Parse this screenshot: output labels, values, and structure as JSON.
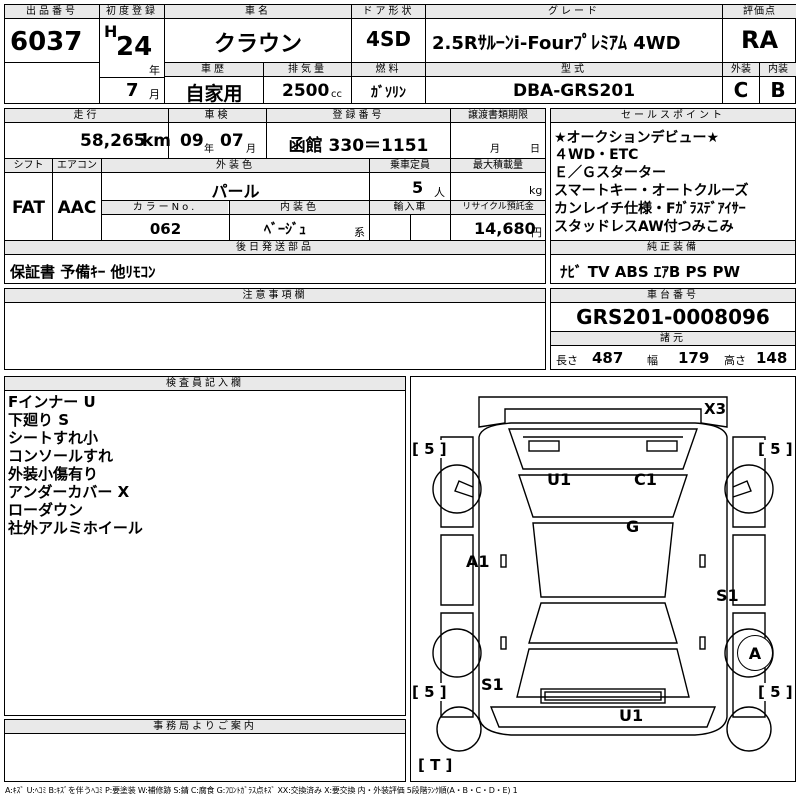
{
  "row1": {
    "lot_number_label": "出品番号",
    "lot_number": "6037",
    "first_reg_label": "初度登録",
    "era": "H",
    "year": "24",
    "year_unit": "年",
    "month": "7",
    "month_unit": "月",
    "car_name_label": "車名",
    "car_name": "クラウン",
    "door_label": "ドア形状",
    "door": "4SD",
    "grade_label": "グレード",
    "grade": "2.5Rｻﾙｰﾝi-Fourﾌﾟﾚﾐｱﾑ 4WD",
    "score_label": "評価点",
    "score": "RA",
    "history_label": "車歴",
    "history": "自家用",
    "displacement_label": "排気量",
    "displacement": "2500",
    "displacement_unit": "cc",
    "fuel_label": "燃料",
    "fuel": "ｶﾞｿﾘﾝ",
    "model_label": "型式",
    "model": "DBA-GRS201",
    "exterior_label": "外装",
    "exterior": "C",
    "interior_label": "内装",
    "interior": "B"
  },
  "row2": {
    "mileage_label": "走行",
    "mileage": "58,265",
    "mileage_unit": "km",
    "inspection_label": "車検",
    "insp_year": "09",
    "insp_year_unit": "年",
    "insp_month": "07",
    "insp_month_unit": "月",
    "reg_label": "登録番号",
    "reg_number": "函館 330＝1151",
    "transfer_label": "譲渡書類期限",
    "transfer_month_unit": "月",
    "transfer_day_unit": "日"
  },
  "row3": {
    "shift_label": "シフト",
    "shift": "FAT",
    "ac_label": "エアコン",
    "ac": "AAC",
    "color_label": "外装色",
    "color": "パール",
    "capacity_label": "乗車定員",
    "capacity": "5",
    "capacity_unit": "人",
    "max_load_label": "最大積載量",
    "max_load_unit": "kg",
    "color_no_label": "カラーNo.",
    "color_no": "062",
    "interior_color_label": "内装色",
    "interior_color": "ﾍﾞｰｼﾞｭ",
    "interior_color_unit": "系",
    "import_label": "輸入車",
    "recycle_label": "リサイクル預託金",
    "recycle": "14,680",
    "recycle_unit": "円"
  },
  "later_parts": {
    "label": "後日発送部品",
    "value": "保証書 予備ｷｰ 他ﾘﾓｺﾝ"
  },
  "sales_points": {
    "label": "セールスポイント",
    "lines": [
      "★オークションデビュー★",
      "４WD・ETC",
      "Ｅ／Ｇスターター",
      "スマートキー・オートクルーズ",
      "カンレイチ仕様・Fｶﾞﾗｽﾃﾞｱｲｻｰ",
      "スタッドレスAW付つみこみ"
    ]
  },
  "equipment": {
    "label": "純正装備",
    "value": "ﾅﾋﾞ TV ABS ｴｱB PS PW"
  },
  "caution": {
    "label": "注意事項欄"
  },
  "chassis": {
    "label": "車台番号",
    "number": "GRS201-0008096",
    "dims_label": "諸元",
    "length_label": "長さ",
    "length": "487",
    "width_label": "幅",
    "width": "179",
    "height_label": "高さ",
    "height": "148"
  },
  "inspector": {
    "label": "検査員記入欄",
    "lines": [
      "Fインナー U",
      "下廻り S",
      "シートすれ小",
      "コンソールすれ",
      "外装小傷有り",
      "アンダーカバー X",
      "ローダウン",
      "社外アルミホイール"
    ]
  },
  "office": {
    "label": "事務局よりご案内"
  },
  "diagram": {
    "marks": {
      "x3": "X3",
      "u1_top": "U1",
      "c1": "C1",
      "g": "G",
      "a1": "A1",
      "s1_right": "S1",
      "a_circle": "A",
      "s1_left": "S1",
      "u1_bottom": "U1"
    },
    "tire_tl": "[ 5 ]",
    "tire_tr": "[ 5 ]",
    "tire_bl": "[ 5 ]",
    "tire_br": "[ 5 ]",
    "spare": "[ T ]"
  },
  "legend": "A:ｷｽﾞ U:ﾍｺﾐ B:ｷｽﾞを伴うﾍｺﾐ P:要塗装 W:補修跡 S:錆 C:腐食 G:ﾌﾛﾝﾄｶﾞﾗｽ点ｷｽﾞ XX:交換済み X:要交換 内・外装評価 5段階ﾗﾝｸ順(A・B・C・D・E) 1"
}
